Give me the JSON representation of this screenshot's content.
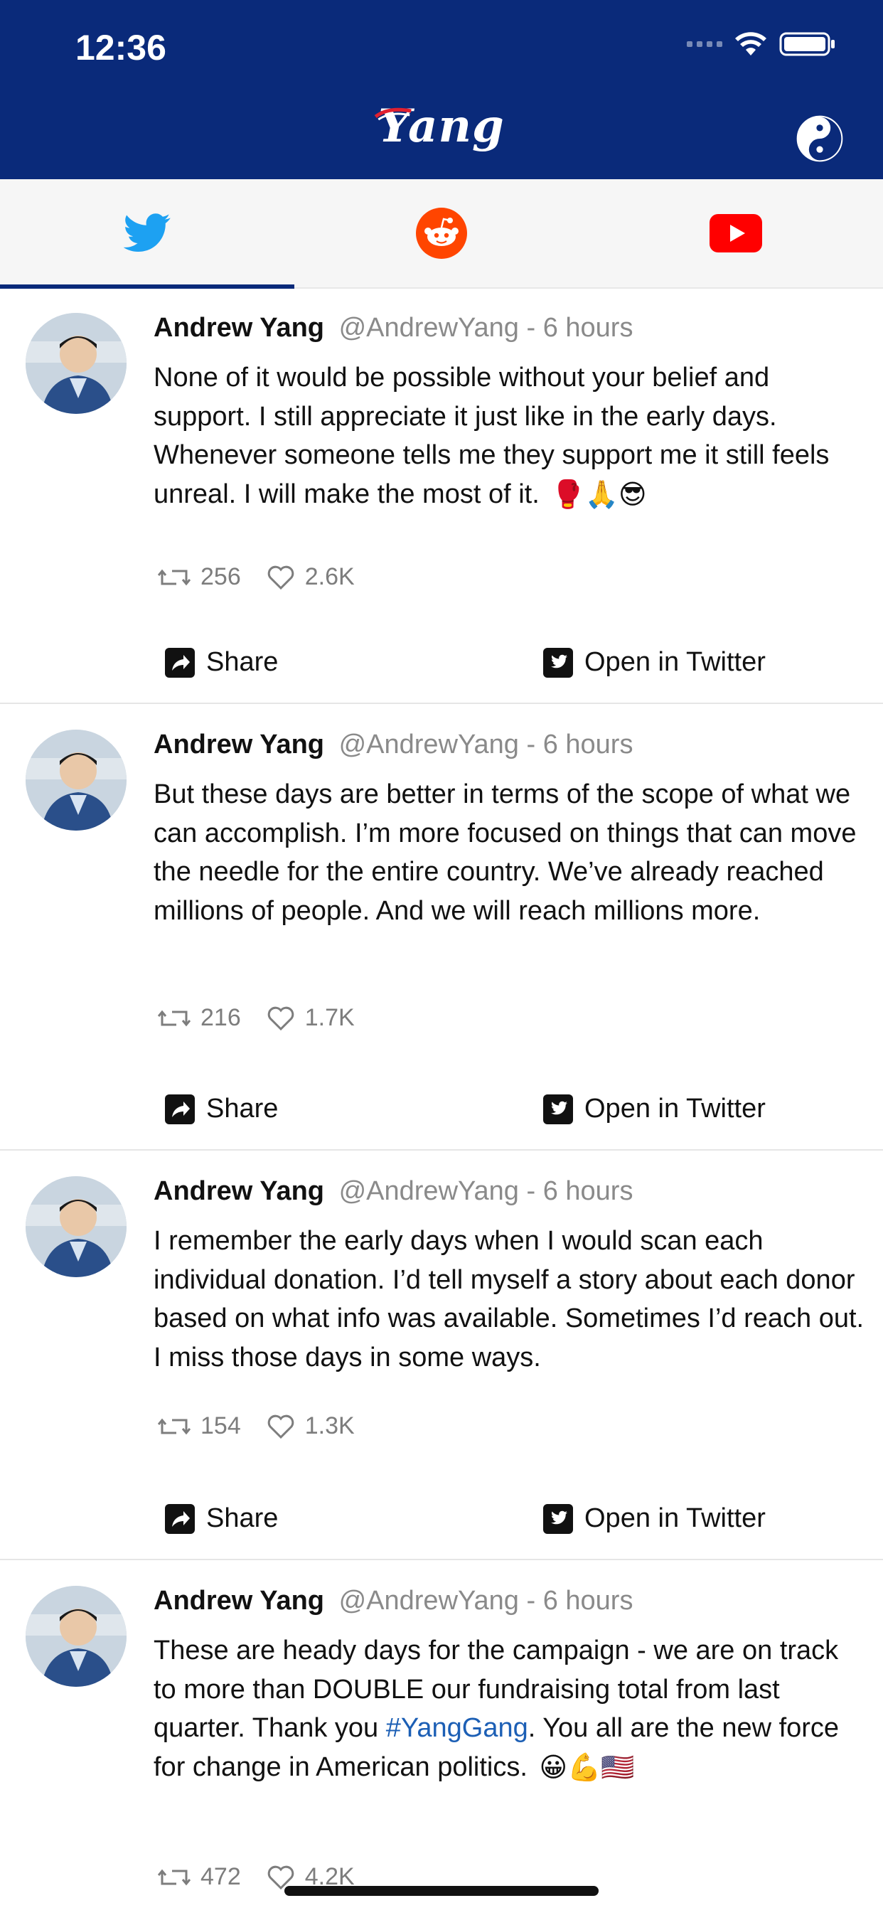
{
  "status_bar": {
    "time": "12:36"
  },
  "header": {
    "logo_text": "Yang",
    "brand_color": "#0a2a7a"
  },
  "tabs": [
    {
      "name": "twitter",
      "icon": "twitter-icon",
      "color": "#1da1f2",
      "selected": true
    },
    {
      "name": "reddit",
      "icon": "reddit-icon",
      "color": "#ff4500",
      "selected": false
    },
    {
      "name": "youtube",
      "icon": "youtube-icon",
      "color": "#ff0000",
      "selected": false
    }
  ],
  "tweets": [
    {
      "name": "Andrew Yang",
      "meta": "@AndrewYang - 6 hours",
      "text": "None of it would be possible without your belief and support.  I still appreciate it just like in the early days.  Whenever someone tells me they support me it still feels unreal.  I will make the most of it.",
      "emojis": "🥊🙏😎",
      "retweets": "256",
      "likes": "2.6K"
    },
    {
      "name": "Andrew Yang",
      "meta": "@AndrewYang - 6 hours",
      "text": "But these days are better in terms of the scope of what we can accomplish.  I’m more focused on things that can move the needle for the entire country.  We’ve already reached millions of people.  And we will reach millions more.",
      "emojis": "",
      "retweets": "216",
      "likes": "1.7K"
    },
    {
      "name": "Andrew Yang",
      "meta": "@AndrewYang - 6 hours",
      "text": "I remember the early days when I would scan each individual donation.   I’d tell myself a story about each donor based on what info was available. Sometimes I’d reach out. I miss those days in some ways.",
      "emojis": "",
      "retweets": "154",
      "likes": "1.3K"
    },
    {
      "name": "Andrew Yang",
      "meta": "@AndrewYang - 6 hours",
      "text_before": "These are heady days for the campaign - we are on track to more than DOUBLE our fundraising total from last quarter.  Thank you ",
      "hashtag": "#YangGang",
      "text_after": ".  You all are the new force for change in American politics.",
      "emojis": "😀💪🇺🇸",
      "retweets": "472",
      "likes": "4.2K"
    }
  ],
  "actions": {
    "share_label": "Share",
    "open_label": "Open in Twitter"
  }
}
